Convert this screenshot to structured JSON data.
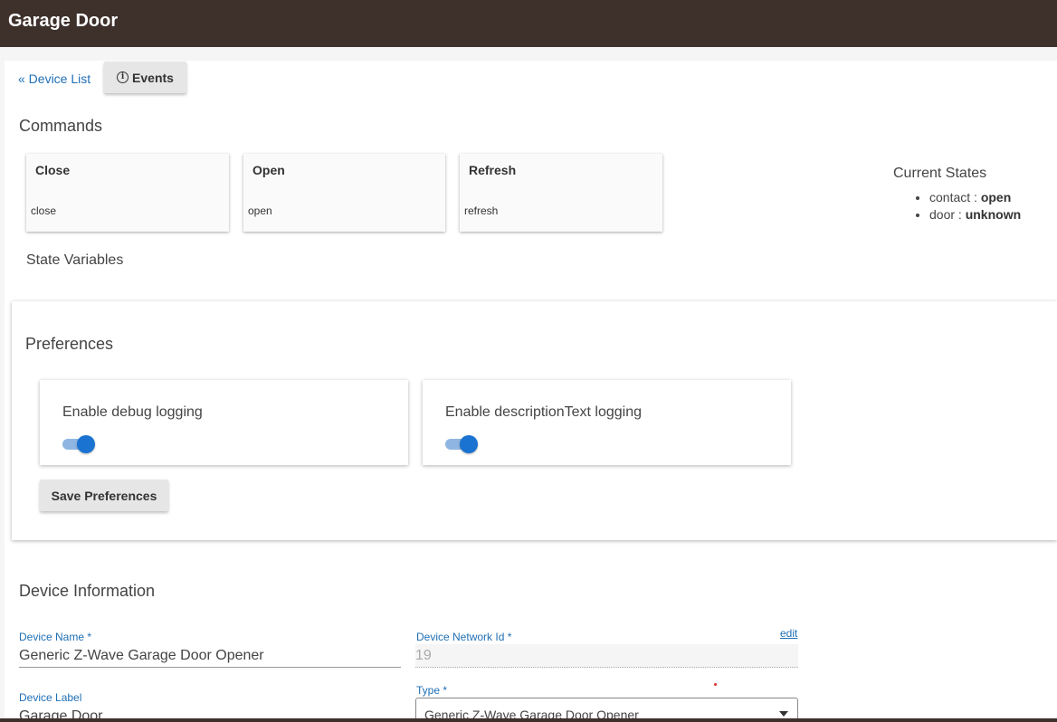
{
  "header": {
    "title": "Garage Door"
  },
  "nav": {
    "device_list": "« Device List",
    "events": "Events"
  },
  "commands": {
    "title": "Commands",
    "items": [
      {
        "name": "Close",
        "sub": "close"
      },
      {
        "name": "Open",
        "sub": "open"
      },
      {
        "name": "Refresh",
        "sub": "refresh"
      }
    ]
  },
  "current_states": {
    "title": "Current States",
    "items": [
      {
        "key": "contact : ",
        "value": "open"
      },
      {
        "key": "door : ",
        "value": "unknown"
      }
    ]
  },
  "state_variables": {
    "title": "State Variables"
  },
  "preferences": {
    "title": "Preferences",
    "items": [
      {
        "label": "Enable debug logging",
        "enabled": true
      },
      {
        "label": "Enable descriptionText logging",
        "enabled": true
      }
    ],
    "save_label": "Save Preferences"
  },
  "device_info": {
    "title": "Device Information",
    "name_label": "Device Name *",
    "name_value": "Generic Z-Wave Garage Door Opener",
    "network_id_label": "Device Network Id *",
    "network_id_value": "19",
    "edit_label": "edit",
    "label_label": "Device Label",
    "label_value": "Garage Door",
    "type_label": "Type *",
    "type_value": "Generic Z-Wave Garage Door Opener"
  },
  "colors": {
    "header_bg": "#3e302b",
    "accent": "#1a73d1",
    "link": "#1f6fb5"
  }
}
